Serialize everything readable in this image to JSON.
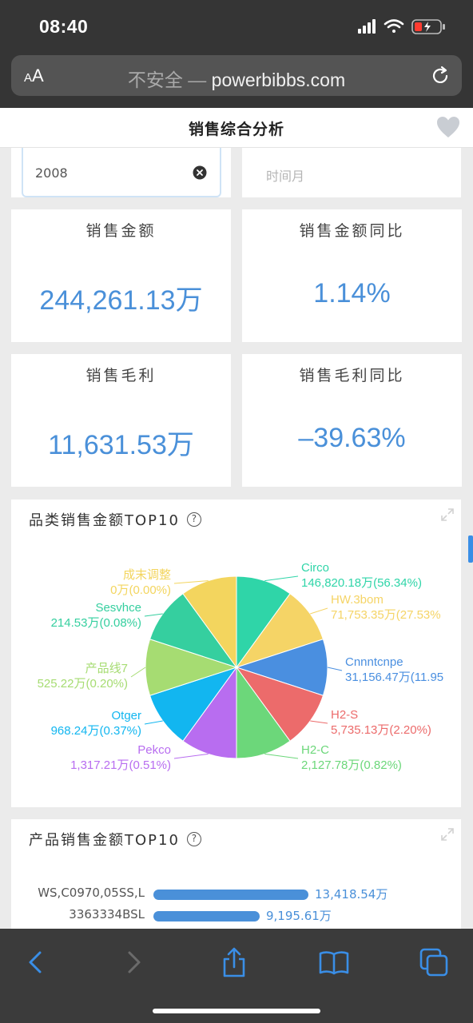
{
  "status_bar": {
    "time": "08:40"
  },
  "browser": {
    "aa_label_small": "A",
    "aa_label_big": "A",
    "url_prefix": "不安全 — ",
    "url_domain": "powerbibbs.com"
  },
  "header": {
    "title": "销售综合分析"
  },
  "filters": {
    "year_value": "2008",
    "month_placeholder": "时间月"
  },
  "kpis": {
    "sales_amount": {
      "label": "销售金额",
      "value": "244,261.13万"
    },
    "sales_yoy": {
      "label": "销售金额同比",
      "value": "1.14%"
    },
    "gross_profit": {
      "label": "销售毛利",
      "value": "11,631.53万"
    },
    "profit_yoy": {
      "label": "销售毛利同比",
      "value": "–39.63%"
    }
  },
  "category_chart": {
    "title": "品类销售金额TOP10",
    "help": "?"
  },
  "product_chart": {
    "title": "产品销售金额TOP10",
    "help": "?"
  },
  "chart_data": [
    {
      "type": "pie",
      "title": "品类销售金额TOP10",
      "slices": [
        {
          "name": "Circo",
          "value": 146820.18,
          "label": "146,820.18万(56.34%)",
          "color": "#2fd5a8"
        },
        {
          "name": "HW.3bom",
          "value": 71753.35,
          "label": "71,753.35万(27.53%",
          "color": "#f5d466"
        },
        {
          "name": "Cnnntcnpe",
          "value": 31156.47,
          "label": "31,156.47万(11.95",
          "color": "#4a8fe0"
        },
        {
          "name": "H2-S",
          "value": 5735.13,
          "label": "5,735.13万(2.20%)",
          "color": "#ec6b6b"
        },
        {
          "name": "H2-C",
          "value": 2127.78,
          "label": "2,127.78万(0.82%)",
          "color": "#6cd77a"
        },
        {
          "name": "Pekco",
          "value": 1317.21,
          "label": "1,317.21万(0.51%)",
          "color": "#b86df0"
        },
        {
          "name": "Otger",
          "value": 968.24,
          "label": "968.24万(0.37%)",
          "color": "#12b6f0"
        },
        {
          "name": "产品线7",
          "value": 525.22,
          "label": "525.22万(0.20%)",
          "color": "#a6dc72"
        },
        {
          "name": "Sesvhce",
          "value": 214.53,
          "label": "214.53万(0.08%)",
          "color": "#35cf9f"
        },
        {
          "name": "成末调整",
          "value": 0,
          "label": "0万(0.00%)",
          "color": "#f3d55e"
        }
      ],
      "note": "slices are drawn with equal angles (rose/pie with min-angle), labels carry true values"
    },
    {
      "type": "bar",
      "title": "产品销售金额TOP10",
      "categories": [
        "WS,C0970,05SS,L",
        "3363334BSL"
      ],
      "values": [
        13418.54
      ],
      "value_labels": [
        "13,418.54万",
        "9,195.61万"
      ],
      "values_all": [
        13418.54,
        9195.61
      ],
      "max": 13418.54
    }
  ]
}
